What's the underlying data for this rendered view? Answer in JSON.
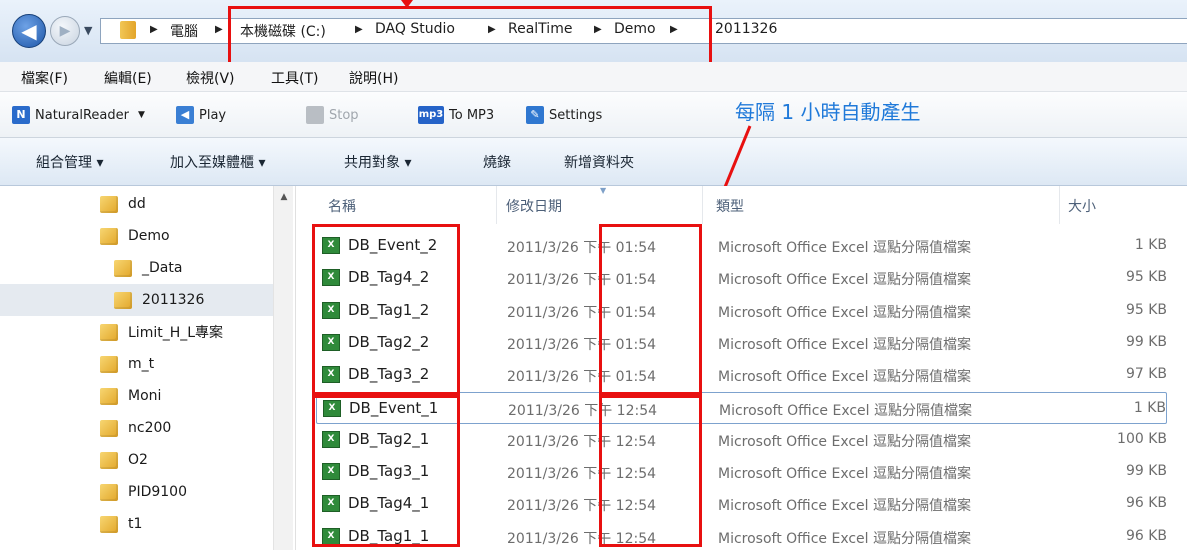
{
  "address": {
    "crumbs": [
      "電腦",
      "本機磁碟 (C:)",
      "DAQ Studio",
      "RealTime",
      "Demo",
      "2011326"
    ]
  },
  "menu": [
    "檔案(F)",
    "編輯(E)",
    "檢視(V)",
    "工具(T)",
    "說明(H)"
  ],
  "toolbar": {
    "naturalreader": "NaturalReader",
    "play": "Play",
    "stop": "Stop",
    "to_mp3": "To MP3",
    "mp3_icon": "mp3",
    "settings": "Settings"
  },
  "commands": [
    "組合管理 ▾",
    "加入至媒體櫃 ▾",
    "共用對象 ▾",
    "燒錄",
    "新增資料夾"
  ],
  "annotation": "每隔 1 小時自動產生",
  "nav": [
    "dd",
    "Demo",
    "_Data",
    "2011326",
    "Limit_H_L專案",
    "m_t",
    "Moni",
    "nc200",
    "O2",
    "PID9100",
    "t1"
  ],
  "columns": {
    "name": "名稱",
    "date": "修改日期",
    "type": "類型",
    "size": "大小"
  },
  "files": [
    {
      "name": "DB_Event_2",
      "date": "2011/3/26 下午 01:54",
      "type": "Microsoft Office Excel 逗點分隔值檔案",
      "size": "1 KB"
    },
    {
      "name": "DB_Tag4_2",
      "date": "2011/3/26 下午 01:54",
      "type": "Microsoft Office Excel 逗點分隔值檔案",
      "size": "95 KB"
    },
    {
      "name": "DB_Tag1_2",
      "date": "2011/3/26 下午 01:54",
      "type": "Microsoft Office Excel 逗點分隔值檔案",
      "size": "95 KB"
    },
    {
      "name": "DB_Tag2_2",
      "date": "2011/3/26 下午 01:54",
      "type": "Microsoft Office Excel 逗點分隔值檔案",
      "size": "99 KB"
    },
    {
      "name": "DB_Tag3_2",
      "date": "2011/3/26 下午 01:54",
      "type": "Microsoft Office Excel 逗點分隔值檔案",
      "size": "97 KB"
    },
    {
      "name": "DB_Event_1",
      "date": "2011/3/26 下午 12:54",
      "type": "Microsoft Office Excel 逗點分隔值檔案",
      "size": "1 KB"
    },
    {
      "name": "DB_Tag2_1",
      "date": "2011/3/26 下午 12:54",
      "type": "Microsoft Office Excel 逗點分隔值檔案",
      "size": "100 KB"
    },
    {
      "name": "DB_Tag3_1",
      "date": "2011/3/26 下午 12:54",
      "type": "Microsoft Office Excel 逗點分隔值檔案",
      "size": "99 KB"
    },
    {
      "name": "DB_Tag4_1",
      "date": "2011/3/26 下午 12:54",
      "type": "Microsoft Office Excel 逗點分隔值檔案",
      "size": "96 KB"
    },
    {
      "name": "DB_Tag1_1",
      "date": "2011/3/26 下午 12:54",
      "type": "Microsoft Office Excel 逗點分隔值檔案",
      "size": "96 KB"
    }
  ]
}
